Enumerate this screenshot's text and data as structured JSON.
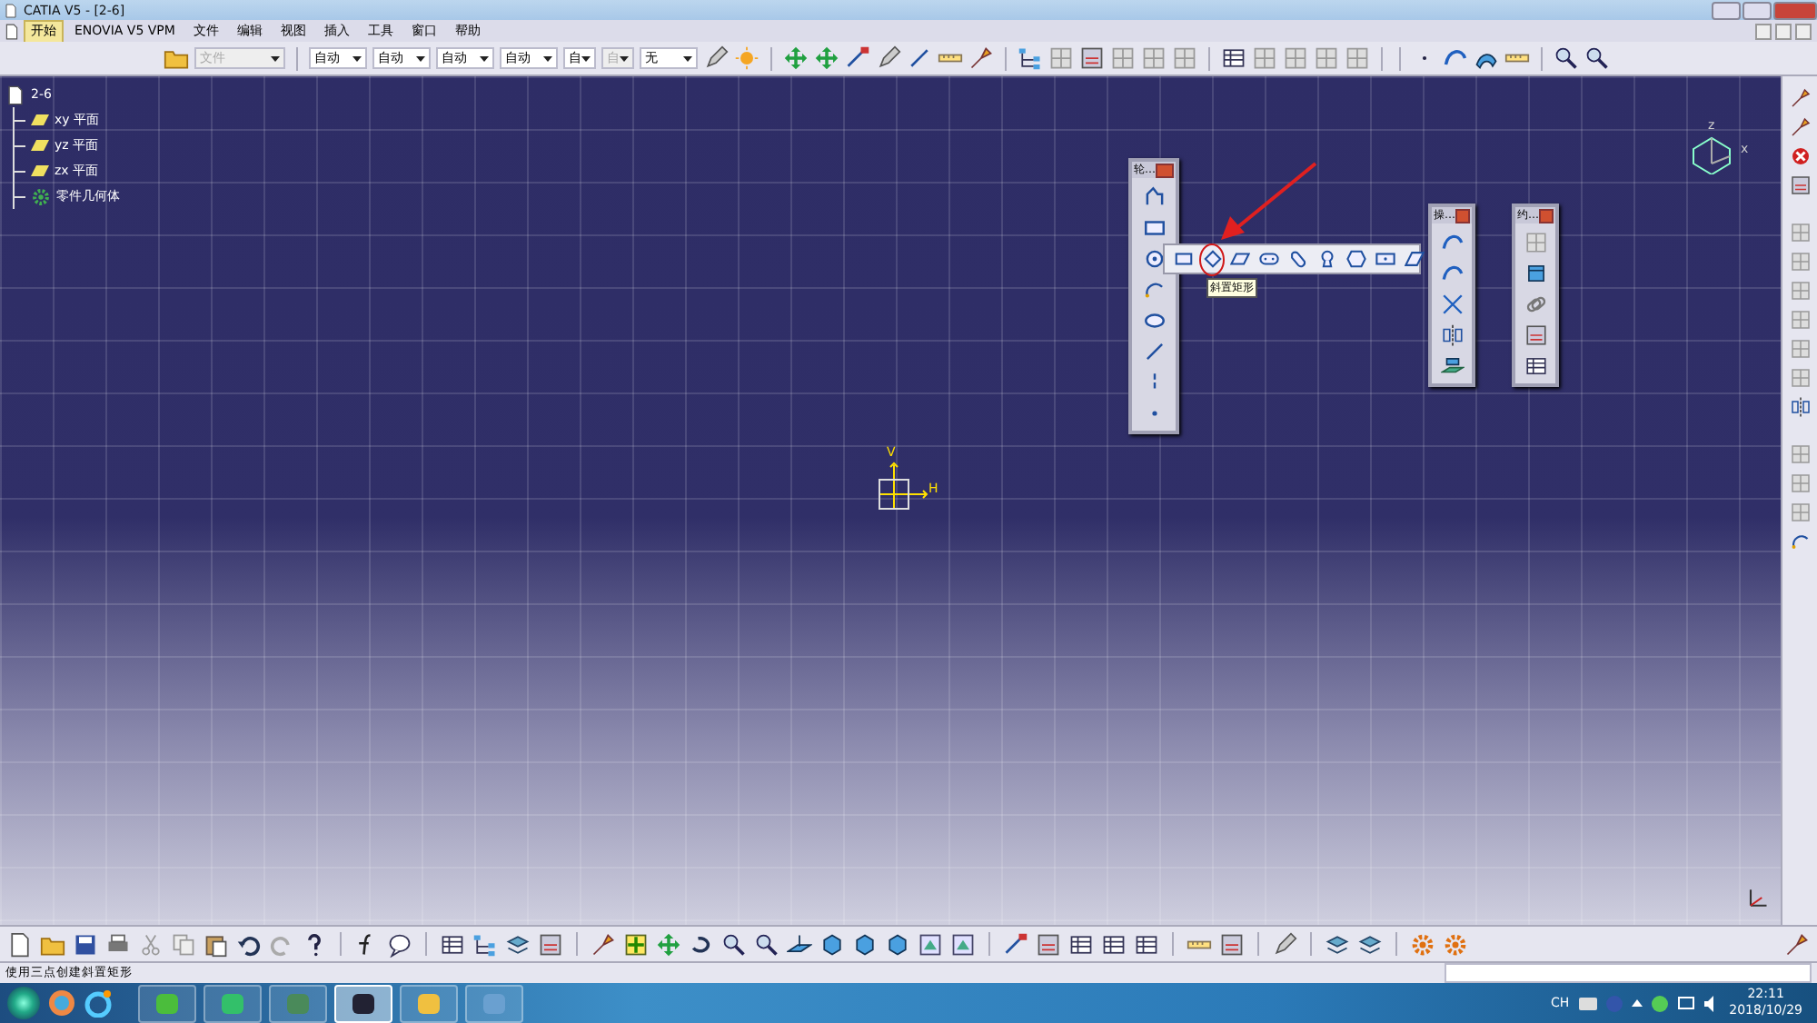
{
  "window": {
    "title": "CATIA V5 - [2-6]"
  },
  "menu": [
    {
      "label": "开始",
      "selected": true
    },
    {
      "label": "ENOVIA V5 VPM",
      "selected": false
    },
    {
      "label": "文件",
      "selected": false
    },
    {
      "label": "编辑",
      "selected": false
    },
    {
      "label": "视图",
      "selected": false
    },
    {
      "label": "插入",
      "selected": false
    },
    {
      "label": "工具",
      "selected": false
    },
    {
      "label": "窗口",
      "selected": false
    },
    {
      "label": "帮助",
      "selected": false
    }
  ],
  "toolbar": {
    "dropdowns": [
      {
        "value": "文件",
        "disabled": true
      },
      {
        "value": "自动",
        "disabled": false
      },
      {
        "value": "自动",
        "disabled": false
      },
      {
        "value": "自动",
        "disabled": false
      },
      {
        "value": "自动",
        "disabled": false
      },
      {
        "value": "自",
        "disabled": false
      },
      {
        "value": "自",
        "disabled": true
      },
      {
        "value": "无",
        "disabled": false
      }
    ]
  },
  "tree": {
    "root": "2-6",
    "children": [
      {
        "label": "xy 平面",
        "kind": "plane"
      },
      {
        "label": "yz 平面",
        "kind": "plane"
      },
      {
        "label": "zx 平面",
        "kind": "plane"
      },
      {
        "label": "零件几何体",
        "kind": "body"
      }
    ]
  },
  "compass": {
    "labels": [
      "z",
      "x"
    ]
  },
  "sketch_axis": {
    "vertical": "V",
    "horizontal": "H"
  },
  "floating_toolbars": [
    {
      "title": "轮…"
    },
    {
      "title": "操…"
    },
    {
      "title": "约…"
    }
  ],
  "flyout": {
    "items": [
      {
        "selected": false
      },
      {
        "selected": true
      },
      {
        "selected": false
      },
      {
        "selected": false
      },
      {
        "selected": false
      },
      {
        "selected": false
      },
      {
        "selected": false
      },
      {
        "selected": false
      },
      {
        "selected": false
      }
    ]
  },
  "tooltip": "斜置矩形",
  "status_bar": {
    "message": "使用三点创建斜置矩形"
  },
  "taskbar": {
    "apps": [
      {
        "selected": false
      },
      {
        "selected": false
      },
      {
        "selected": false
      },
      {
        "selected": true
      },
      {
        "selected": false
      },
      {
        "selected": false
      }
    ],
    "language": "CH",
    "time": "22:11",
    "date": "2018/10/29"
  }
}
